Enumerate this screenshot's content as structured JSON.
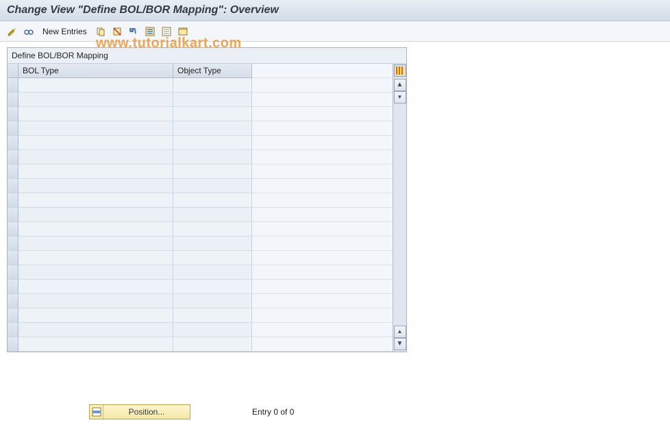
{
  "title": "Change View \"Define BOL/BOR Mapping\": Overview",
  "toolbar": {
    "new_entries_label": "New Entries"
  },
  "frame": {
    "title": "Define BOL/BOR Mapping",
    "columns": {
      "bol_type": "BOL Type",
      "object_type": "Object Type"
    },
    "rows": [
      {
        "bol": "",
        "obj": ""
      },
      {
        "bol": "",
        "obj": ""
      },
      {
        "bol": "",
        "obj": ""
      },
      {
        "bol": "",
        "obj": ""
      },
      {
        "bol": "",
        "obj": ""
      },
      {
        "bol": "",
        "obj": ""
      },
      {
        "bol": "",
        "obj": ""
      },
      {
        "bol": "",
        "obj": ""
      },
      {
        "bol": "",
        "obj": ""
      },
      {
        "bol": "",
        "obj": ""
      },
      {
        "bol": "",
        "obj": ""
      },
      {
        "bol": "",
        "obj": ""
      },
      {
        "bol": "",
        "obj": ""
      },
      {
        "bol": "",
        "obj": ""
      },
      {
        "bol": "",
        "obj": ""
      },
      {
        "bol": "",
        "obj": ""
      },
      {
        "bol": "",
        "obj": ""
      },
      {
        "bol": "",
        "obj": ""
      },
      {
        "bol": "",
        "obj": ""
      }
    ]
  },
  "footer": {
    "position_label": "Position...",
    "entry_status": "Entry 0 of 0"
  },
  "watermark": "www.tutorialkart.com"
}
